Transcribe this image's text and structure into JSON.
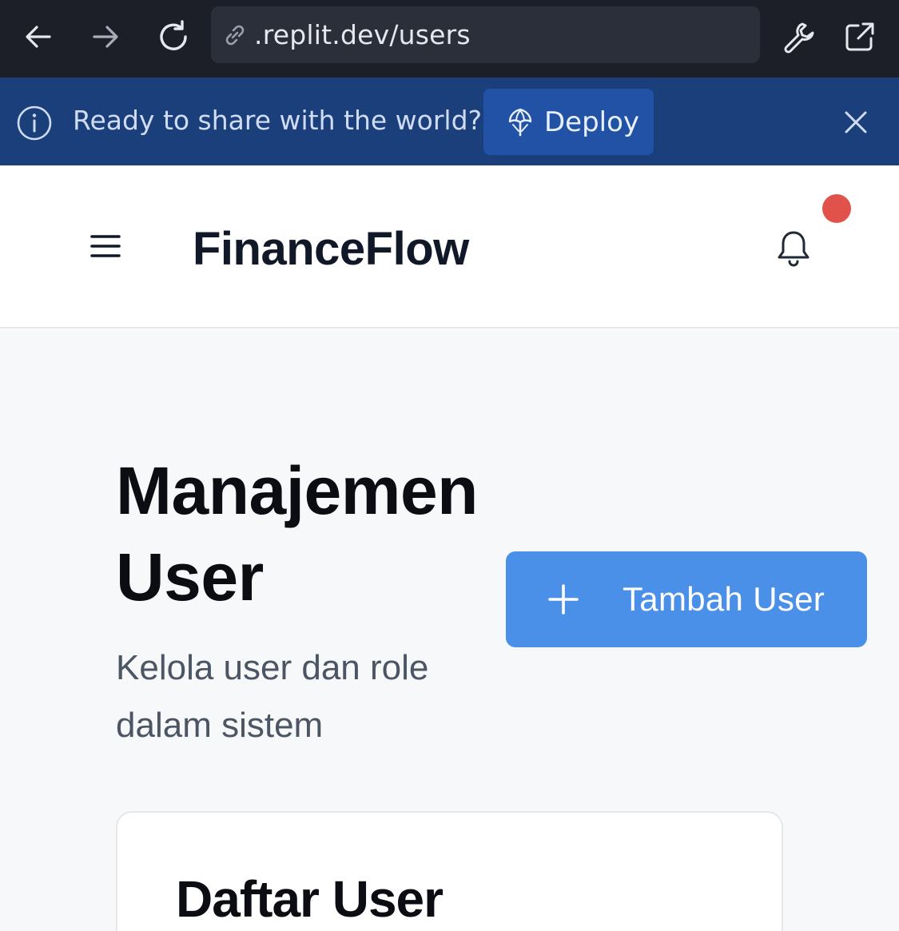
{
  "browser": {
    "url": ".replit.dev/users",
    "icons": {
      "back": "arrow-left-icon",
      "forward": "arrow-right-icon",
      "reload": "reload-icon",
      "link": "link-icon",
      "tools": "wrench-icon",
      "open_external": "external-link-icon"
    }
  },
  "banner": {
    "message": "Ready to share with the world?",
    "deploy_label": "Deploy",
    "background": "#1b3f7b",
    "button_color": "#2152a6"
  },
  "header": {
    "app_title": "FinanceFlow",
    "notification_badge_color": "#e0524a"
  },
  "main": {
    "title": "Manajemen User",
    "subtitle": "Kelola user dan role dalam sistem",
    "add_button_label": "Tambah User",
    "accent_color": "#4a90e8",
    "card": {
      "title": "Daftar User"
    }
  }
}
